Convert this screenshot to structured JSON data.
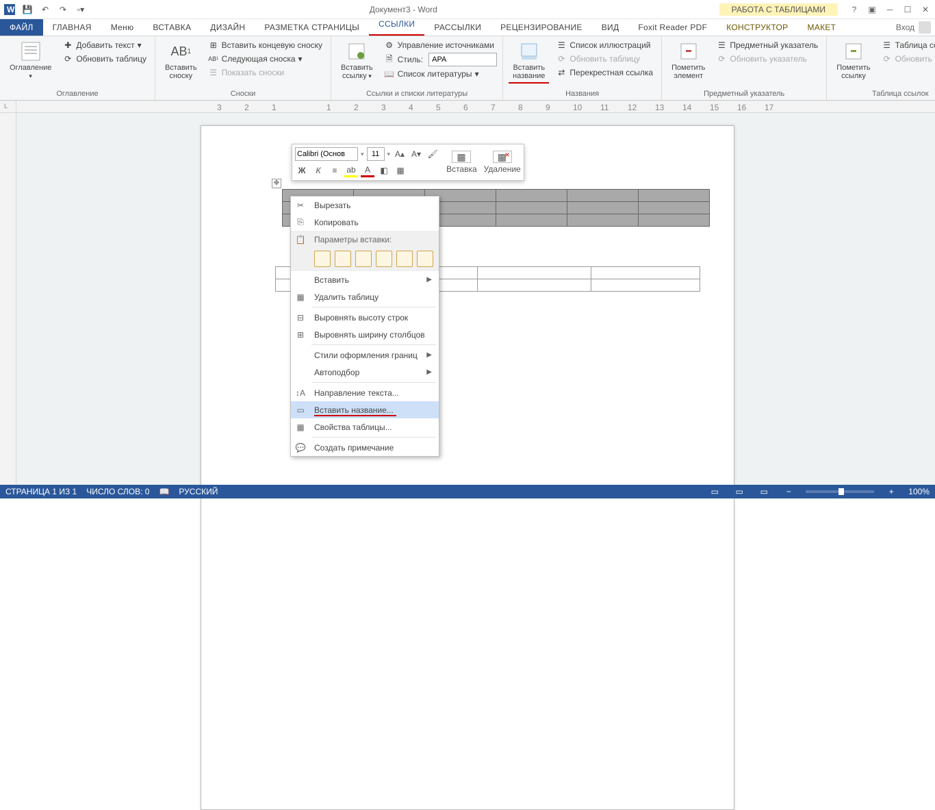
{
  "title": "Документ3 - Word",
  "toolTabLabel": "РАБОТА С ТАБЛИЦАМИ",
  "signIn": "Вход",
  "tabs": {
    "file": "ФАЙЛ",
    "home": "ГЛАВНАЯ",
    "menu": "Меню",
    "insert": "ВСТАВКА",
    "design": "ДИЗАЙН",
    "layout": "РАЗМЕТКА СТРАНИЦЫ",
    "references": "ССЫЛКИ",
    "mailings": "РАССЫЛКИ",
    "review": "РЕЦЕНЗИРОВАНИЕ",
    "view": "ВИД",
    "foxit": "Foxit Reader PDF",
    "design2": "КОНСТРУКТОР",
    "layout2": "МАКЕТ"
  },
  "ribbon": {
    "toc": {
      "btn": "Оглавление",
      "add": "Добавить текст",
      "update": "Обновить таблицу",
      "group": "Оглавление"
    },
    "foot": {
      "btn": "Вставить сноску",
      "endnote": "Вставить концевую сноску",
      "next": "Следующая сноска",
      "show": "Показать сноски",
      "group": "Сноски"
    },
    "cite": {
      "btn": "Вставить ссылку",
      "manage": "Управление источниками",
      "styleLbl": "Стиль:",
      "styleVal": "APA",
      "bib": "Список литературы",
      "group": "Ссылки и списки литературы"
    },
    "cap": {
      "btn": "Вставить название",
      "figs": "Список иллюстраций",
      "update": "Обновить таблицу",
      "xref": "Перекрестная ссылка",
      "group": "Названия"
    },
    "mark": {
      "btn": "Пометить элемент",
      "index": "Предметный указатель",
      "update": "Обновить указатель",
      "group": "Предметный указатель"
    },
    "auth": {
      "btn": "Пометить ссылку",
      "table": "Таблица ссылок",
      "update": "Обновить таблицу",
      "group": "Таблица ссылок"
    }
  },
  "miniToolbar": {
    "font": "Calibri (Основ",
    "size": "11",
    "insert": "Вставка",
    "delete": "Удаление"
  },
  "context": {
    "cut": "Вырезать",
    "copy": "Копировать",
    "pasteOpts": "Параметры вставки:",
    "insert": "Вставить",
    "delTable": "Удалить таблицу",
    "distRows": "Выровнять высоту строк",
    "distCols": "Выровнять ширину столбцов",
    "borderStyles": "Стили оформления границ",
    "autoFit": "Автоподбор",
    "textDir": "Направление текста...",
    "insCaption": "Вставить название...",
    "tblProps": "Свойства таблицы...",
    "newComment": "Создать примечание"
  },
  "status": {
    "page": "СТРАНИЦА 1 ИЗ 1",
    "words": "ЧИСЛО СЛОВ: 0",
    "lang": "РУССКИЙ",
    "zoom": "100%"
  },
  "ruler": {
    "corner": "L"
  }
}
